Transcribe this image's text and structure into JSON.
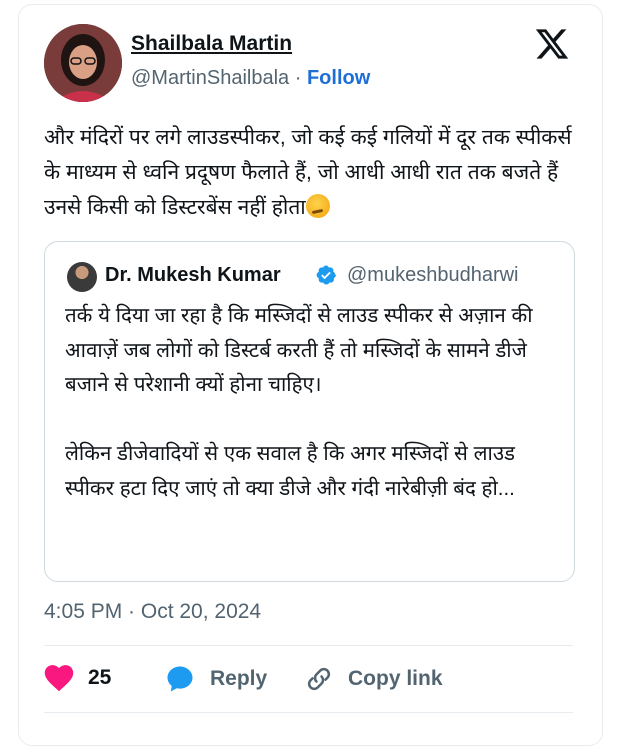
{
  "author": {
    "name": "Shailbala Martin",
    "handle": "@MartinShailbala",
    "separator": "·",
    "follow_label": "Follow"
  },
  "tweet": {
    "text": "और मंदिरों पर लगे लाउडस्पीकर, जो कई कई गलियों में दूर तक स्पीकर्स के माध्यम से ध्वनि प्रदूषण फैलाते हैं, जो आधी आधी रात तक बजते हैं उनसे किसी को डिस्टरबेंस नहीं होता",
    "emoji": "thinking-face-icon"
  },
  "quote": {
    "name": "Dr. Mukesh Kumar",
    "handle": "@mukeshbudharwi",
    "verified": true,
    "text": "तर्क ये दिया जा रहा है कि मस्जिदों से लाउड स्पीकर से अज़ान की आवाज़ें जब लोगों को डिस्टर्ब करती हैं तो मस्जिदों के सामने डीजे बजाने से परेशानी क्यों होना चाहिए।\n\nलेकिन डीजेवादियों से एक सवाल है कि अगर मस्जिदों से लाउड स्पीकर हटा दिए जाएं तो क्या डीजे और गंदी नारेबीज़ी बंद हो..."
  },
  "timestamp": "4:05 PM · Oct 20, 2024",
  "actions": {
    "like_count": "25",
    "reply_label": "Reply",
    "copy_label": "Copy link"
  },
  "colors": {
    "follow": "#1d6fd6",
    "like": "#f91880",
    "reply": "#1d9bf0",
    "verified": "#1d9bf0"
  }
}
